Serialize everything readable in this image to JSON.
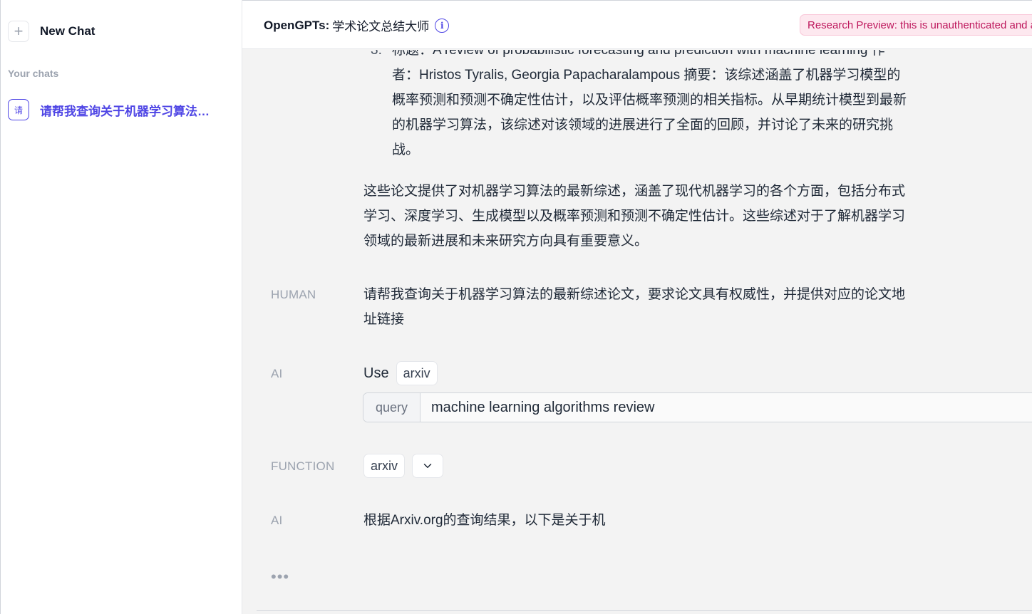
{
  "sidebar": {
    "new_chat_label": "New Chat",
    "plus_glyph": "+",
    "section_label": "Your chats",
    "chats": [
      {
        "avatar": "请",
        "title": "请帮我查询关于机器学习算法的最新综述论文，要求论文具有权威性，并提供对应的论文地址链接",
        "active": true
      }
    ]
  },
  "header": {
    "brand": "OpenGPTs:",
    "bot_name": "学术论文总结大师",
    "info_glyph": "i",
    "notice": "Research Preview: this is unauthenticated and all data can be found. Do not use with sensitive data"
  },
  "messages": {
    "list_item": {
      "number": "3.",
      "lines": [
        "标题：A review of probabilistic forecasting and prediction with machine learning 作",
        "者：Hristos Tyralis, Georgia Papacharalampous 摘要：该综述涵盖了机器学习模型的",
        "概率预测和预测不确定性估计，以及评估概率预测的相关指标。从早期统计模型到最新",
        "的机器学习算法，该综述对该领域的进展进行了全面的回顾，并讨论了未来的研究挑",
        "战。"
      ]
    },
    "summary_lines": [
      "这些论文提供了对机器学习算法的最新综述，涵盖了现代机器学习的各个方面，包括分布式",
      "学习、深度学习、生成模型以及概率预测和预测不确定性估计。这些综述对于了解机器学习",
      "领域的最新进展和未来研究方向具有重要意义。"
    ],
    "human": {
      "role": "HUMAN",
      "lines": [
        "请帮我查询关于机器学习算法的最新综述论文，要求论文具有权威性，并提供对应的论文地",
        "址链接"
      ]
    },
    "ai_tool": {
      "role": "AI",
      "use_label": "Use",
      "tool_name": "arxiv",
      "arg_key": "query",
      "arg_value": "machine learning algorithms review"
    },
    "function": {
      "role": "FUNCTION",
      "tool_name": "arxiv"
    },
    "ai_reply": {
      "role": "AI",
      "text": "根据Arxiv.org的查询结果，以下是关于机"
    },
    "typing_indicator": "•••"
  },
  "colors": {
    "accent": "#4f46e5",
    "badge_bg": "#fde8ef",
    "badge_text": "#be185d"
  }
}
